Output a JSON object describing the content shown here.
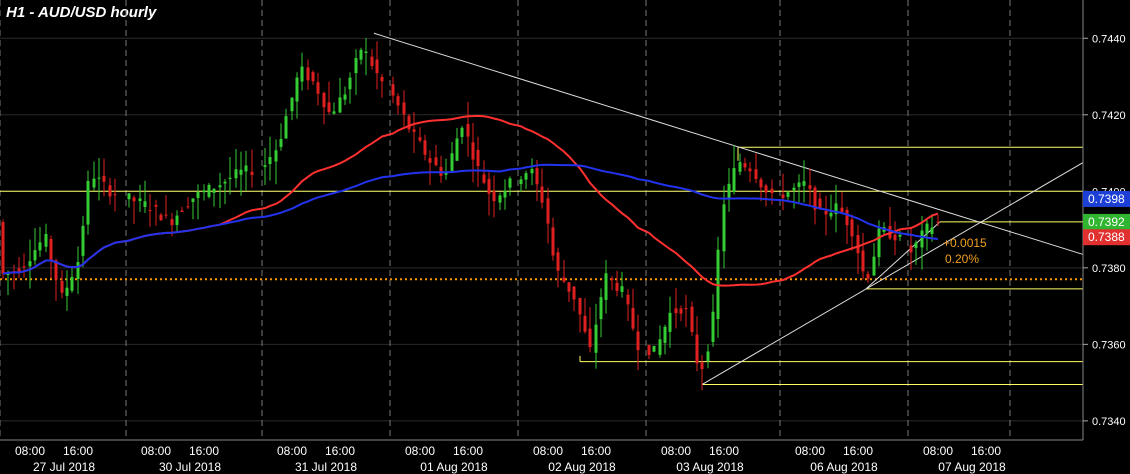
{
  "chart_data": {
    "type": "candlestick",
    "title": "H1 - AUD/USD hourly",
    "ylim": [
      0.7335,
      0.745
    ],
    "y_ticks": [
      0.734,
      0.736,
      0.738,
      0.74,
      0.742,
      0.744
    ],
    "y_tick_labels": [
      "0.7340",
      "0.7360",
      "0.7380",
      "0.7400",
      "0.7420",
      "0.7440"
    ],
    "days": [
      {
        "date": "27 Jul 2018",
        "times": [
          "08:00",
          "16:00"
        ]
      },
      {
        "date": "30 Jul 2018",
        "times": [
          "08:00",
          "16:00"
        ]
      },
      {
        "date": "31 Jul 2018",
        "times": [
          "08:00",
          "16:00"
        ]
      },
      {
        "date": "01 Aug 2018",
        "times": [
          "08:00",
          "16:00"
        ]
      },
      {
        "date": "02 Aug 2018",
        "times": [
          "08:00",
          "16:00"
        ]
      },
      {
        "date": "03 Aug 2018",
        "times": [
          "08:00",
          "16:00"
        ]
      },
      {
        "date": "06 Aug 2018",
        "times": [
          "08:00",
          "16:00"
        ]
      },
      {
        "date": "07 Aug 2018",
        "times": [
          "08:00",
          "16:00"
        ]
      }
    ],
    "price_tags": [
      {
        "label": "0.7398",
        "value": 0.7398,
        "color": "#1c3fd6"
      },
      {
        "label": "0.7392",
        "value": 0.7392,
        "color": "#2fb52f"
      },
      {
        "label": "0.7388",
        "value": 0.7388,
        "color": "#e03030"
      }
    ],
    "change": {
      "abs": "+0.0015",
      "pct": "0.20%",
      "color": "#f0a020"
    },
    "horizontal_levels": [
      {
        "value": 0.74,
        "color": "#ffff66",
        "style": "solid"
      },
      {
        "value": 0.7377,
        "color": "#ff9900",
        "style": "dotted"
      }
    ],
    "candle_colors": {
      "up": "#33cc33",
      "down": "#e02020"
    },
    "ma_colors": {
      "red": "#ff3030",
      "blue": "#2233ee"
    },
    "candles": [],
    "grid": true
  }
}
